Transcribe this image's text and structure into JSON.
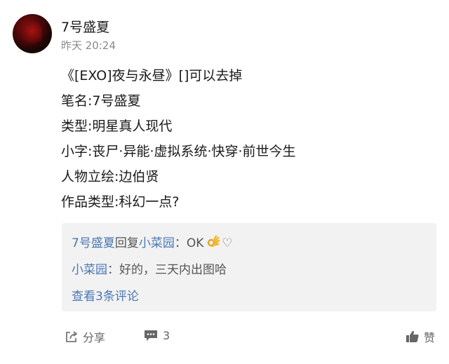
{
  "post": {
    "author": "7号盛夏",
    "time": "昨天 20:24",
    "lines": [
      "《[EXO]夜与永昼》[]可以去掉",
      "笔名:7号盛夏",
      "类型:明星真人现代",
      "小字:丧尸·异能·虚拟系统·快穿·前世今生",
      "人物立绘:边伯贤",
      "作品类型:科幻一点?"
    ]
  },
  "comments": {
    "reply": {
      "from": "7号盛夏",
      "verb": "回复",
      "to": "小菜园",
      "sep": "：",
      "text": "OK",
      "emoji": "ok-hand",
      "heart": "♡"
    },
    "second": {
      "user": "小菜园",
      "sep": "：",
      "text": "好的，三天内出图哈"
    },
    "more": "查看3条评论"
  },
  "toolbar": {
    "share_label": "分享",
    "comment_count": "3",
    "like_label": "赞"
  },
  "colors": {
    "link": "#4a77b5",
    "muted": "#8a8a8a",
    "comment_bg": "#f2f2f2"
  }
}
